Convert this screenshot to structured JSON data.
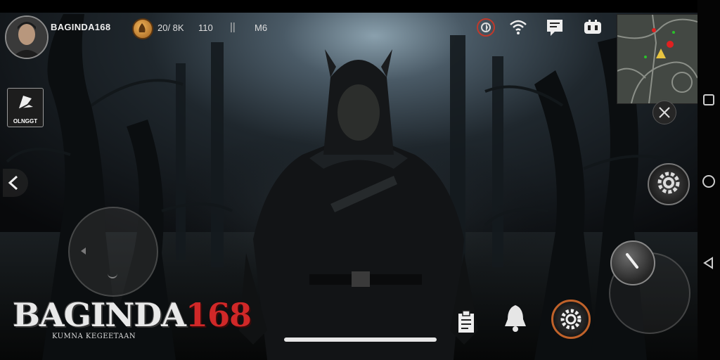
{
  "player": {
    "name": "BAGINDA168"
  },
  "stats": {
    "coins": "20/ 8K",
    "level": "110",
    "separator": "||",
    "extra": "M6"
  },
  "side_button": {
    "label": "OLNGGT"
  },
  "logo": {
    "word": "BAGINDA",
    "number": "168",
    "tagline": "KUMNA KEGEETAAN"
  },
  "icons": {
    "coin": "coin-icon",
    "compass": "compass-icon",
    "wifi": "wifi-icon",
    "chat": "chat-icon",
    "gamepad": "gamepad-icon",
    "map_toggle": "crossed-swords-icon",
    "settings": "gear-icon",
    "attack": "attack-icon",
    "clipboard": "clipboard-icon",
    "bell": "bell-icon"
  },
  "colors": {
    "accent_red": "#d02828",
    "accent_orange": "#c0622a",
    "hud_text": "#e8e8e8"
  }
}
